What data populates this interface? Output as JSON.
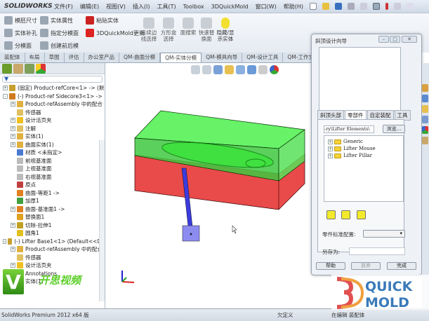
{
  "app": {
    "logo": "SOLIDWORKS",
    "status": "SolidWorks Premium 2012 x64 版",
    "status_right": [
      "在编辑 装配体",
      "欠定义"
    ]
  },
  "menu": [
    "文件(F)",
    "编辑(E)",
    "视图(V)",
    "插入(I)",
    "工具(T)",
    "Toolbox",
    "3DQuickMold",
    "窗口(W)",
    "帮助(H)"
  ],
  "commands": {
    "col1": [
      "模胚尺寸",
      "实体补孔",
      "分模面"
    ],
    "col2": [
      "实体属性",
      "指定分模面",
      "创建前后模"
    ],
    "col3": [
      "粘贴实体",
      "3DQuickMold更新"
    ],
    "big": [
      "连续边线选择",
      "方形盒选择",
      "面搜索",
      "快速替换面",
      "隐藏/显示实体"
    ]
  },
  "tabs": [
    "装配体",
    "布局",
    "草图",
    "评估",
    "办公室产品",
    "QM-曲面分模",
    "QM-实体分模",
    "QM-模具向导",
    "QM-设计工具",
    "QM-工作文档"
  ],
  "active_tab": "QM-实体分模",
  "tree": [
    {
      "level": 0,
      "exp": "+",
      "label": "(固定) Product-refCore<1> -> (默",
      "color": "#c8a030"
    },
    {
      "level": 0,
      "exp": "-",
      "label": "(-) Product-ref Sidecore3<1> ->",
      "color": "#d07a20"
    },
    {
      "level": 1,
      "exp": "+",
      "label": "Product-refAssembly 中的配合",
      "color": "#e0b040"
    },
    {
      "level": 1,
      "exp": "",
      "label": "传感器",
      "color": "#e0c060"
    },
    {
      "level": 1,
      "exp": "+",
      "label": "设计活页夹",
      "color": "#f0c020"
    },
    {
      "level": 1,
      "exp": "+",
      "label": "注解",
      "color": "#e0c060"
    },
    {
      "level": 1,
      "exp": "+",
      "label": "实体(1)",
      "color": "#e0b040"
    },
    {
      "level": 1,
      "exp": "+",
      "label": "曲面实体(1)",
      "color": "#e0b040"
    },
    {
      "level": 1,
      "exp": "",
      "label": "材质 <未指定>",
      "color": "#4a7ad0"
    },
    {
      "level": 1,
      "exp": "",
      "label": "前视基准面",
      "color": "#bbbbbb"
    },
    {
      "level": 1,
      "exp": "",
      "label": "上视基准面",
      "color": "#bbbbbb"
    },
    {
      "level": 1,
      "exp": "",
      "label": "右视基准面",
      "color": "#bbbbbb"
    },
    {
      "level": 1,
      "exp": "",
      "label": "原点",
      "color": "#c04040"
    },
    {
      "level": 1,
      "exp": "",
      "label": "曲面-等距1 ->",
      "color": "#e08020"
    },
    {
      "level": 1,
      "exp": "",
      "label": "加厚1",
      "color": "#40a040"
    },
    {
      "level": 1,
      "exp": "+",
      "label": "曲面-基准面1 ->",
      "color": "#e08020"
    },
    {
      "level": 1,
      "exp": "",
      "label": "替换面1",
      "color": "#e0a020"
    },
    {
      "level": 1,
      "exp": "+",
      "label": "切除-拉伸1",
      "color": "#c0a020"
    },
    {
      "level": 1,
      "exp": "",
      "label": "圆角1",
      "color": "#e0c020"
    },
    {
      "level": 0,
      "exp": "-",
      "label": "(-) Lifter Base1<1> (Default<<De",
      "color": "#c8a030"
    },
    {
      "level": 1,
      "exp": "+",
      "label": "Product-refAssembly 中的配合",
      "color": "#e0b040"
    },
    {
      "level": 1,
      "exp": "",
      "label": "传感器",
      "color": "#e0c060"
    },
    {
      "level": 1,
      "exp": "+",
      "label": "设计活页夹",
      "color": "#f0c020"
    },
    {
      "level": 1,
      "exp": "+",
      "label": "Annotations",
      "color": "#e0c060"
    },
    {
      "level": 1,
      "exp": "+",
      "label": "实体(1)",
      "color": "#e0b040"
    }
  ],
  "dialog": {
    "title": "斜顶设计向导",
    "tabs": [
      "斜顶头部",
      "零部件",
      "自定装配",
      "工具"
    ],
    "active_tab": "零部件",
    "path": "-ry\\Lifter Elements\\",
    "browse": "浏览...",
    "library": [
      "Generic",
      "Lifter Mouse",
      "Lifter Pillar"
    ],
    "config_label": "零件标准配置:",
    "config_value": "",
    "saveas_label": "另存为:",
    "saveas_value": "",
    "buttons": [
      "帮助",
      "放弃",
      "完成"
    ]
  },
  "watermark": {
    "letter": "V",
    "text": "开思视频",
    "brand": "QUICK MOLD"
  },
  "colors": {
    "core": "#e84040",
    "cavity": "#3fe03f",
    "lifter": "#3030d0"
  }
}
